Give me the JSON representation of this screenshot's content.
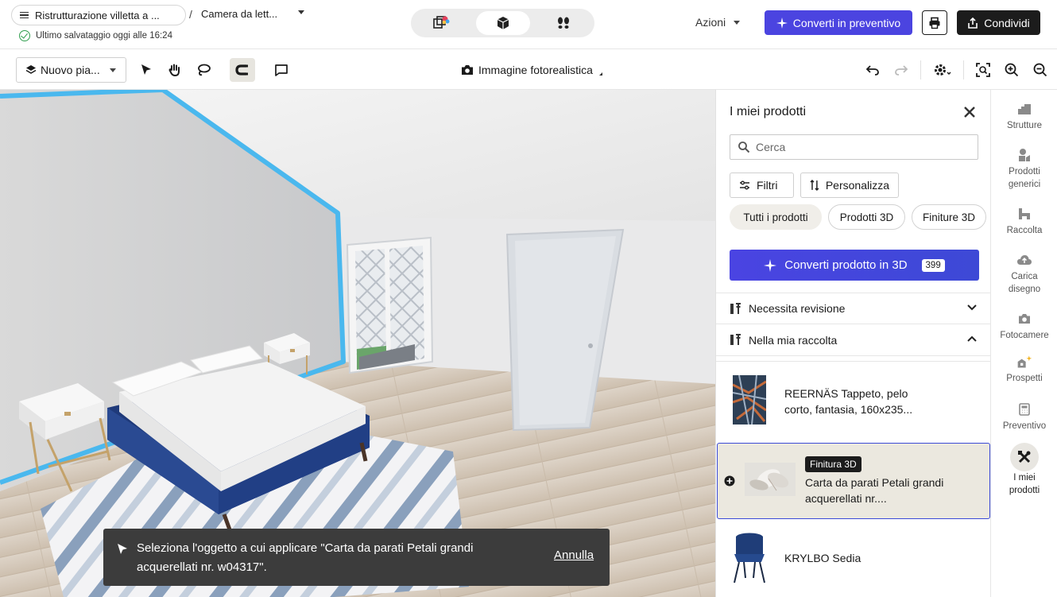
{
  "header": {
    "project_name": "Ristrutturazione villetta a ...",
    "separator": "/",
    "room_name": "Camera da lett...",
    "save_status": "Ultimo salvataggio oggi alle 16:24",
    "actions_label": "Azioni",
    "convert_label": "Converti in preventivo",
    "share_label": "Condividi",
    "view_modes": [
      "2d-3d-view-icon",
      "3d-box-view-icon",
      "walkthrough-footprints-icon"
    ],
    "active_view": "3d-box-view-icon"
  },
  "toolbar": {
    "floor_select_label": "Nuovo pia...",
    "photo_mode_label": "Immagine fotorealistica",
    "tools": [
      "select-arrow-icon",
      "pan-hand-icon",
      "lasso-icon",
      "magnet-icon",
      "comment-icon"
    ],
    "active_tool": "magnet-icon",
    "right_tools": [
      "undo-icon",
      "redo-icon",
      "settings-icon",
      "fit-view-icon",
      "zoom-in-icon",
      "zoom-out-icon"
    ]
  },
  "toast": {
    "message": "Seleziona l'oggetto a cui applicare \"Carta da parati Petali grandi acquerellati nr. w04317\".",
    "undo_label": "Annulla"
  },
  "panel": {
    "title": "I miei prodotti",
    "search_placeholder": "Cerca",
    "filters_label": "Filtri",
    "customize_label": "Personalizza",
    "tabs": [
      {
        "label": "Tutti i prodotti",
        "active": true
      },
      {
        "label": "Prodotti 3D",
        "active": false
      },
      {
        "label": "Finiture 3D",
        "active": false
      }
    ],
    "convert_3d_label": "Converti prodotto in 3D",
    "convert_3d_count": "399",
    "sections": [
      {
        "label": "Necessita revisione",
        "expanded": false
      },
      {
        "label": "Nella mia raccolta",
        "expanded": true
      }
    ],
    "items": [
      {
        "name": "REERNÄS Tappeto, pelo corto, fantasia, 160x235...",
        "badge": "",
        "selected": false
      },
      {
        "name": "Carta da parati Petali grandi acquerellati nr....",
        "badge": "Finitura 3D",
        "selected": true
      },
      {
        "name": "KRYLBO Sedia",
        "badge": "",
        "selected": false
      }
    ]
  },
  "rail": {
    "items": [
      {
        "label": "Strutture",
        "icon": "structures-icon"
      },
      {
        "label": "Prodotti generici",
        "icon": "generic-products-icon"
      },
      {
        "label": "Raccolta",
        "icon": "collection-icon"
      },
      {
        "label": "Carica disegno",
        "icon": "upload-drawing-icon"
      },
      {
        "label": "Fotocamere",
        "icon": "camera-icon"
      },
      {
        "label": "Prospetti",
        "icon": "elevations-icon"
      },
      {
        "label": "Preventivo",
        "icon": "calculator-icon"
      },
      {
        "label": "I miei prodotti",
        "icon": "my-products-icon"
      }
    ],
    "active": "I miei prodotti"
  },
  "colors": {
    "accent": "#4b44e0",
    "selection_outline": "#4ab8ee",
    "toast_bg": "#3c3c3c",
    "dark_button": "#1c1c1c"
  }
}
